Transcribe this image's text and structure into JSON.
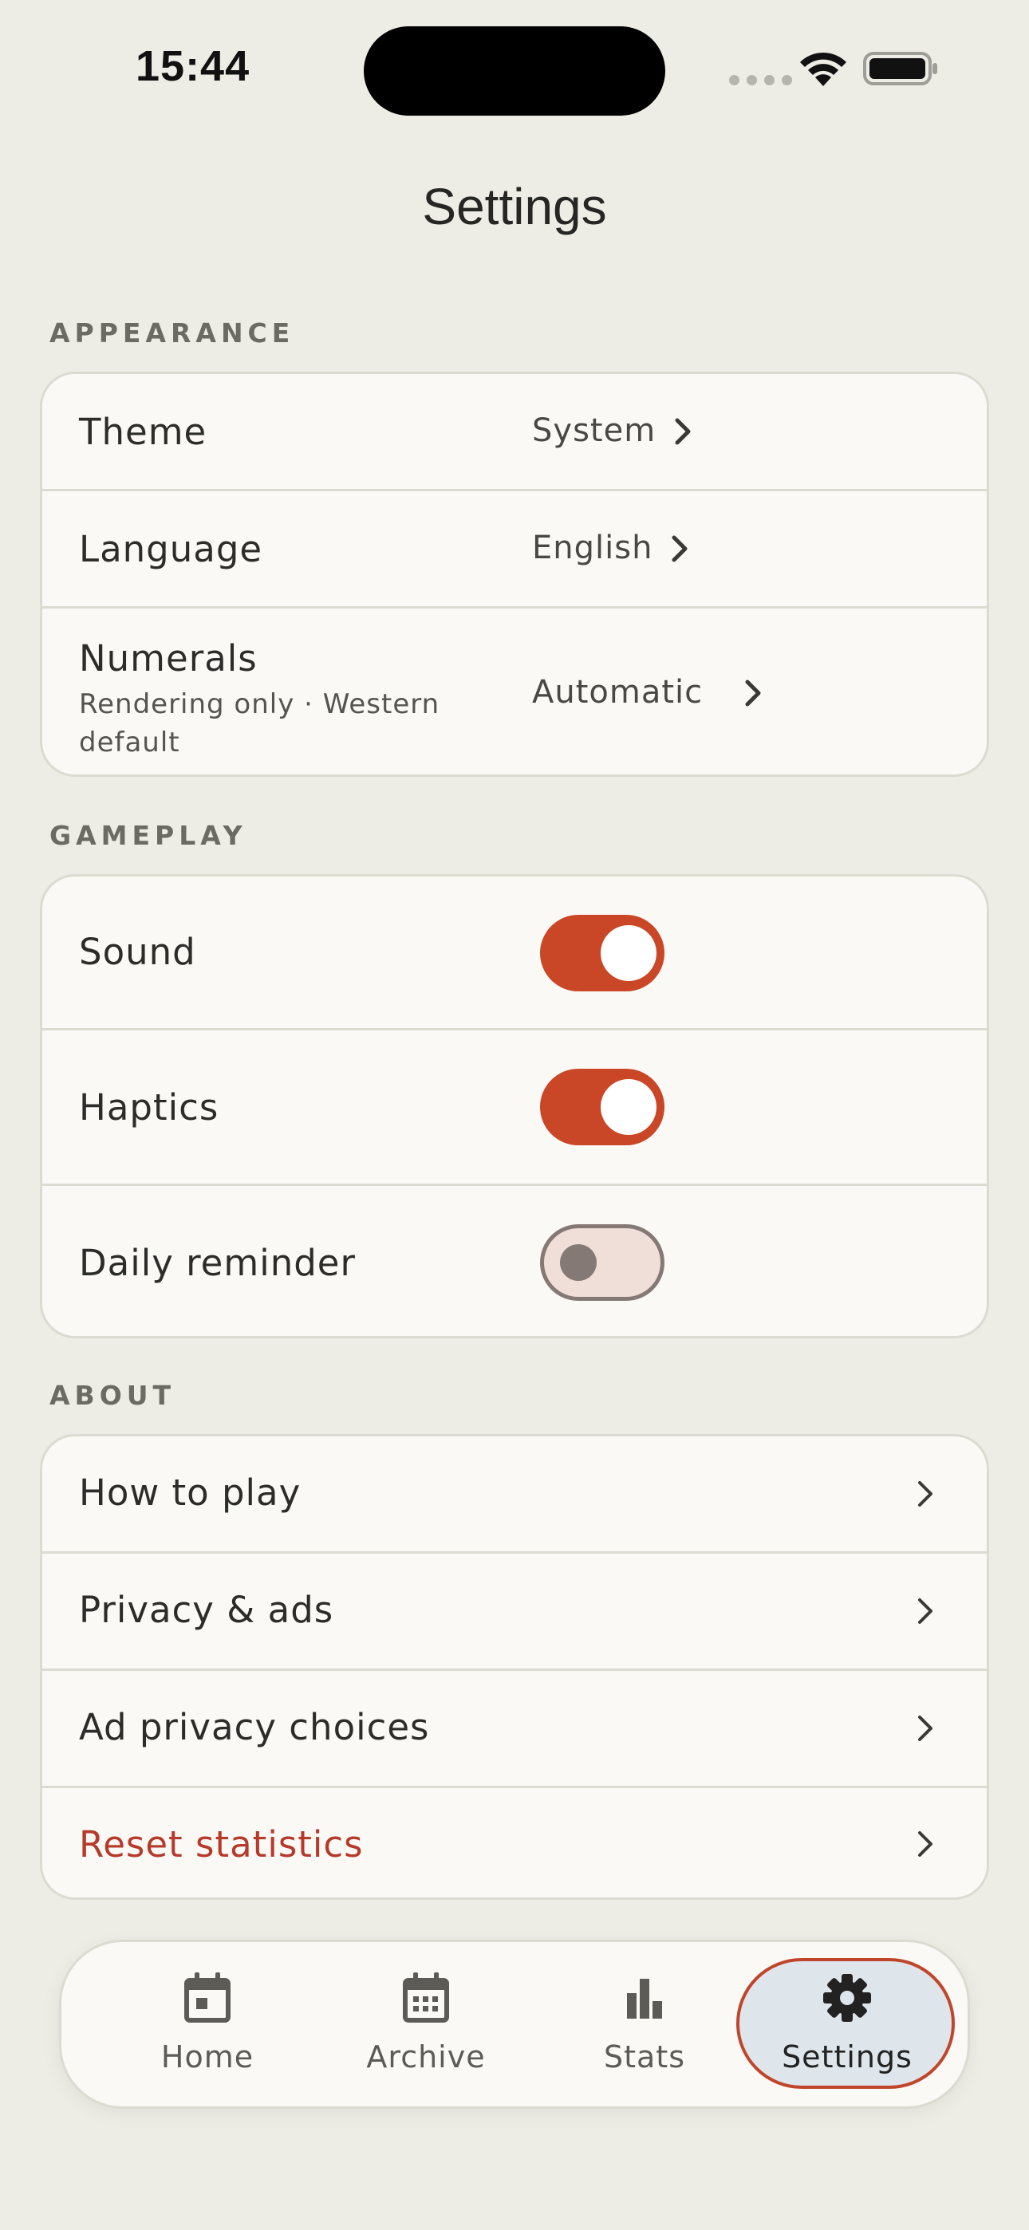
{
  "status_bar": {
    "time": "15:44"
  },
  "page": {
    "title": "Settings"
  },
  "sections": {
    "appearance": {
      "label": "APPEARANCE",
      "theme": {
        "label": "Theme",
        "value": "System"
      },
      "language": {
        "label": "Language",
        "value": "English"
      },
      "numerals": {
        "label": "Numerals",
        "sublabel": "Rendering only · Western default",
        "value": "Automatic"
      }
    },
    "gameplay": {
      "label": "GAMEPLAY",
      "sound": {
        "label": "Sound",
        "enabled": true
      },
      "haptics": {
        "label": "Haptics",
        "enabled": true
      },
      "daily_reminder": {
        "label": "Daily reminder",
        "enabled": false
      }
    },
    "about": {
      "label": "ABOUT",
      "how_to_play": {
        "label": "How to play"
      },
      "privacy_ads": {
        "label": "Privacy & ads"
      },
      "ad_privacy_choices": {
        "label": "Ad privacy choices"
      },
      "reset_statistics": {
        "label": "Reset statistics"
      }
    }
  },
  "tab_bar": {
    "items": [
      {
        "label": "Home",
        "icon": "calendar-today-icon",
        "active": false
      },
      {
        "label": "Archive",
        "icon": "calendar-grid-icon",
        "active": false
      },
      {
        "label": "Stats",
        "icon": "bar-chart-icon",
        "active": false
      },
      {
        "label": "Settings",
        "icon": "gear-icon",
        "active": true
      }
    ]
  },
  "colors": {
    "background": "#EDECE5",
    "card": "#FAF9F5",
    "accent": "#C94727",
    "danger_text": "#B63A2B",
    "active_tab_fill": "#DEE6EC"
  }
}
